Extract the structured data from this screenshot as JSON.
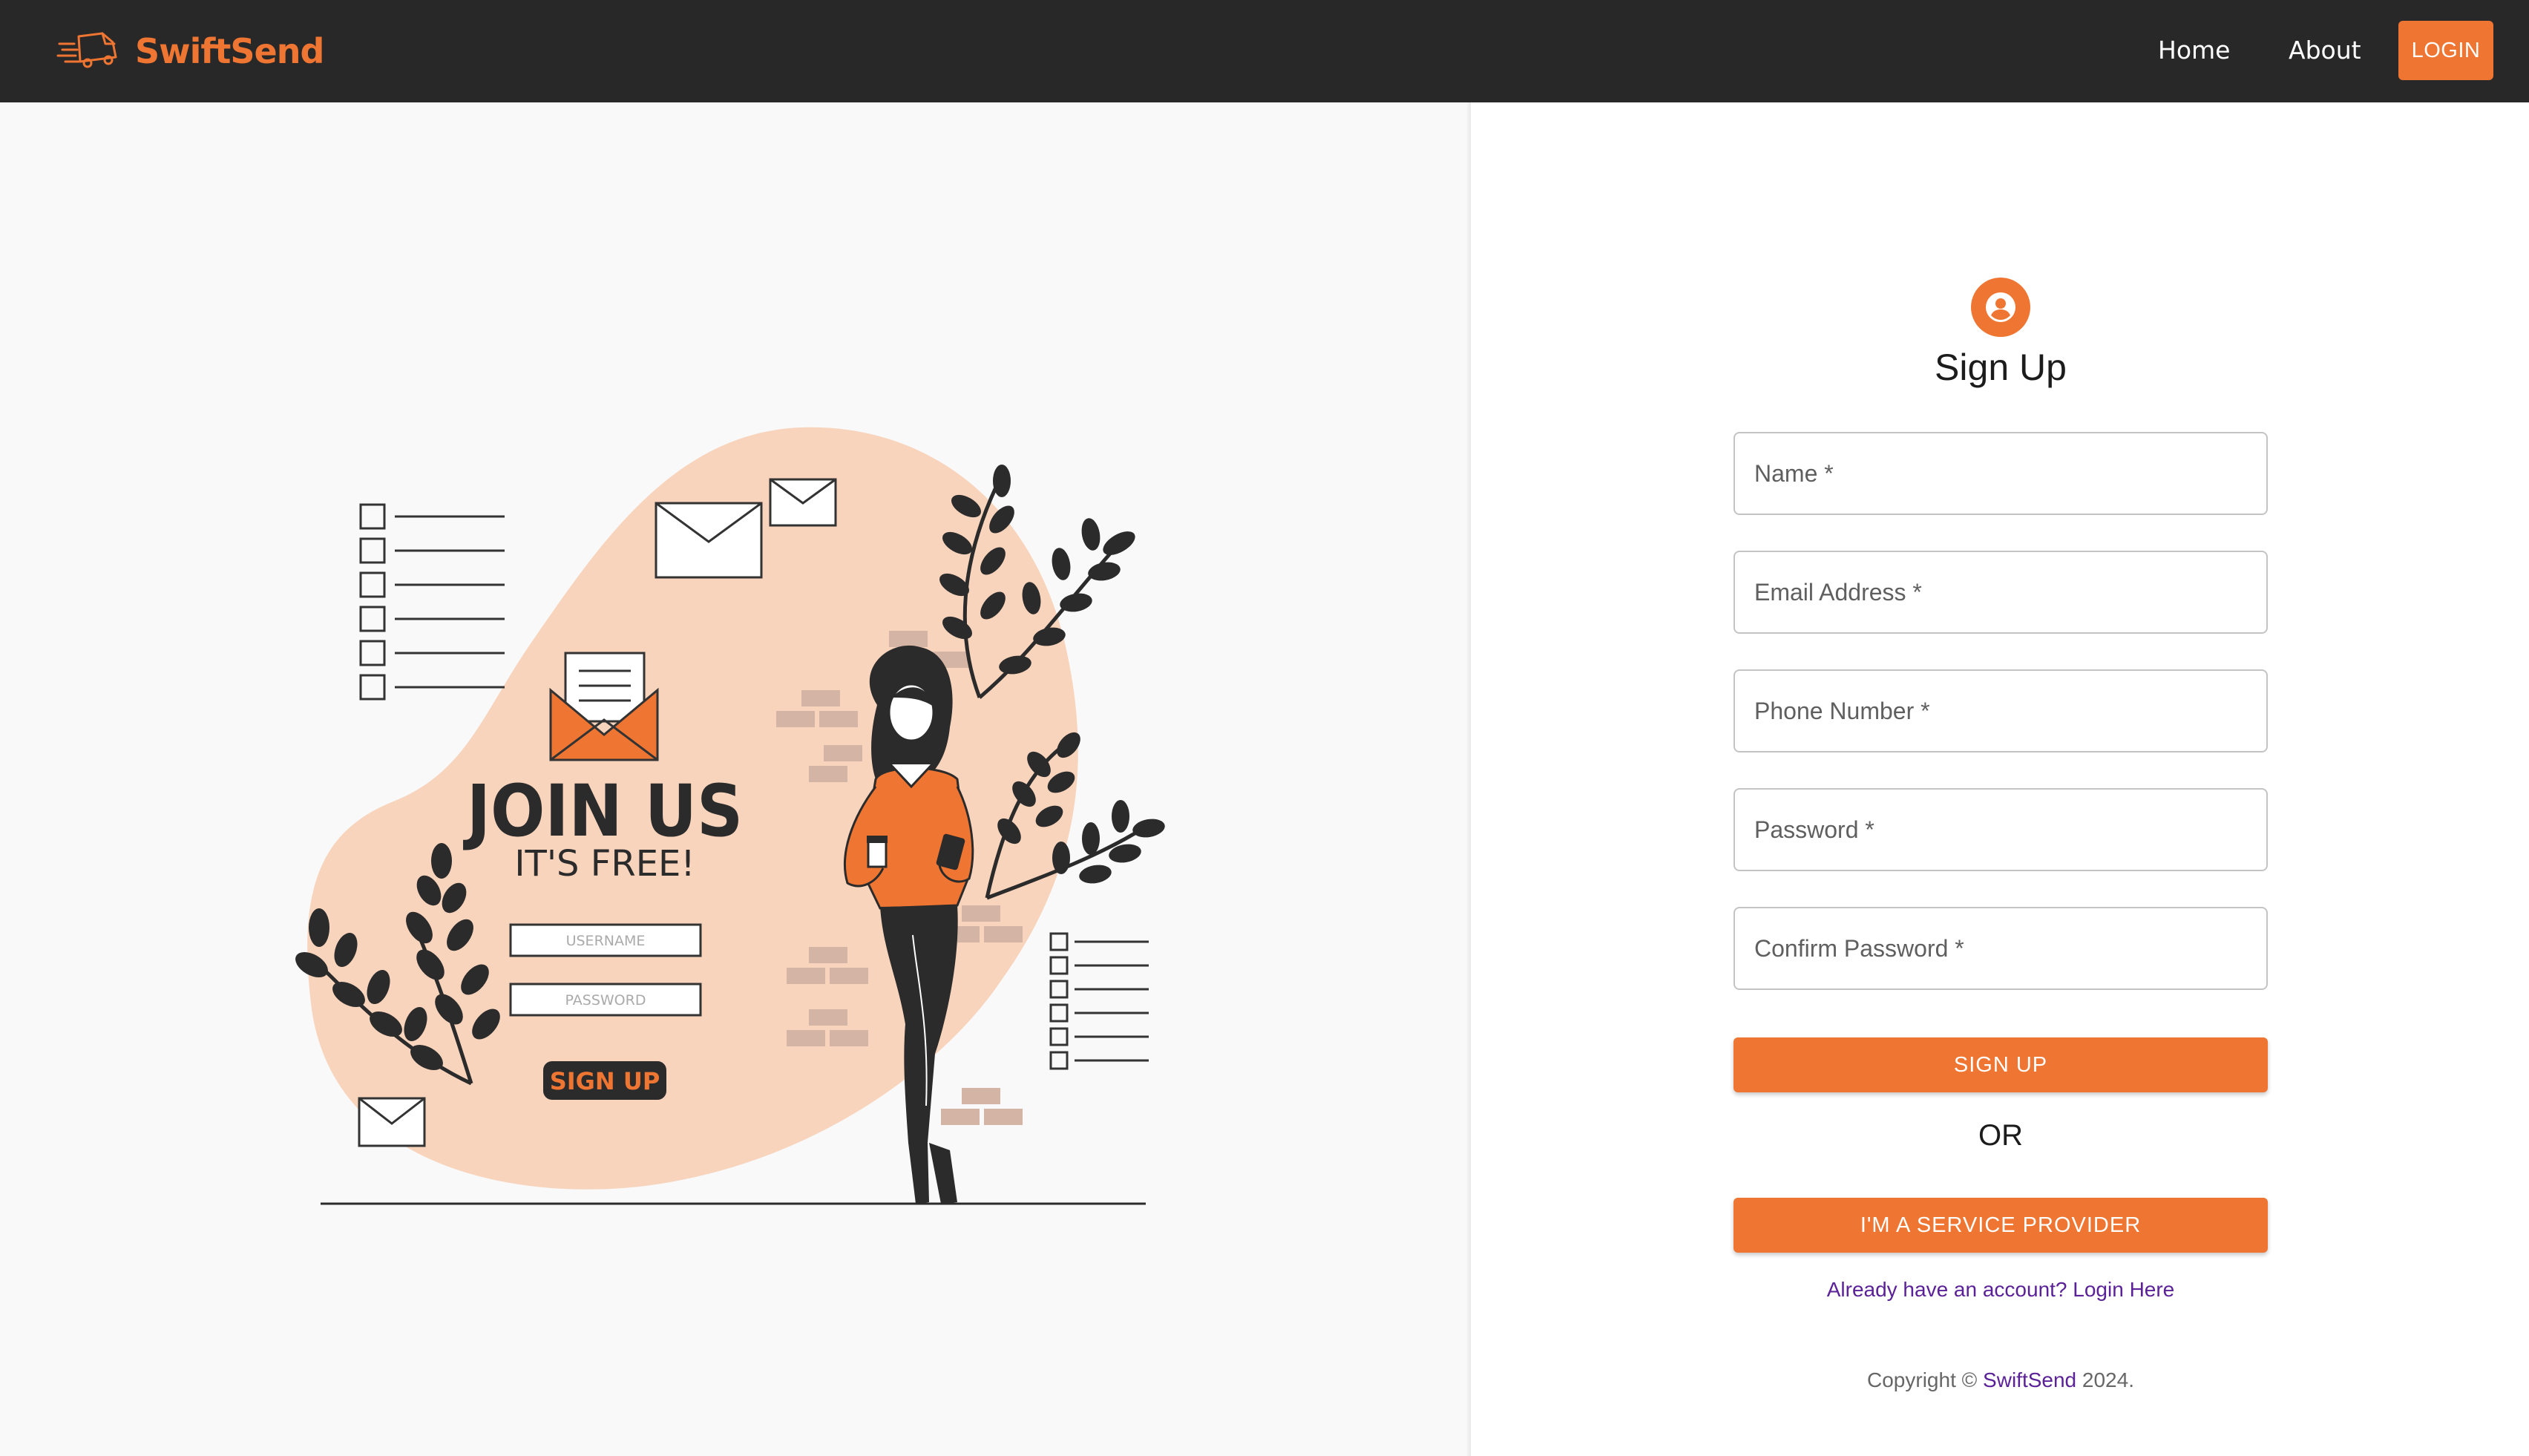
{
  "navbar": {
    "brand_name": "SwiftSend",
    "brand_icon": "delivery-truck-icon",
    "links": {
      "home": "Home",
      "about": "About"
    },
    "login_label": "LOGIN"
  },
  "illustration": {
    "heading": "JOIN US",
    "subheading": "IT'S FREE!",
    "username_placeholder": "USERNAME",
    "password_placeholder": "PASSWORD",
    "button_label": "SIGN UP"
  },
  "form": {
    "icon": "account-circle-icon",
    "title": "Sign Up",
    "fields": {
      "name": {
        "placeholder": "Name *",
        "value": ""
      },
      "email": {
        "placeholder": "Email Address *",
        "value": ""
      },
      "phone": {
        "placeholder": "Phone Number *",
        "value": ""
      },
      "password": {
        "placeholder": "Password *",
        "value": ""
      },
      "confirm_password": {
        "placeholder": "Confirm Password *",
        "value": ""
      }
    },
    "signup_label": "SIGN UP",
    "or_text": "OR",
    "provider_label": "I'M A SERVICE PROVIDER",
    "login_link": "Already have an account? Login Here"
  },
  "footer": {
    "copyright_prefix": "Copyright © ",
    "brand": "SwiftSend",
    "year_suffix": " 2024."
  },
  "colors": {
    "accent": "#ef7532",
    "navbar_bg": "#282828",
    "link": "#5b2196",
    "blob": "#f8d4bd"
  }
}
